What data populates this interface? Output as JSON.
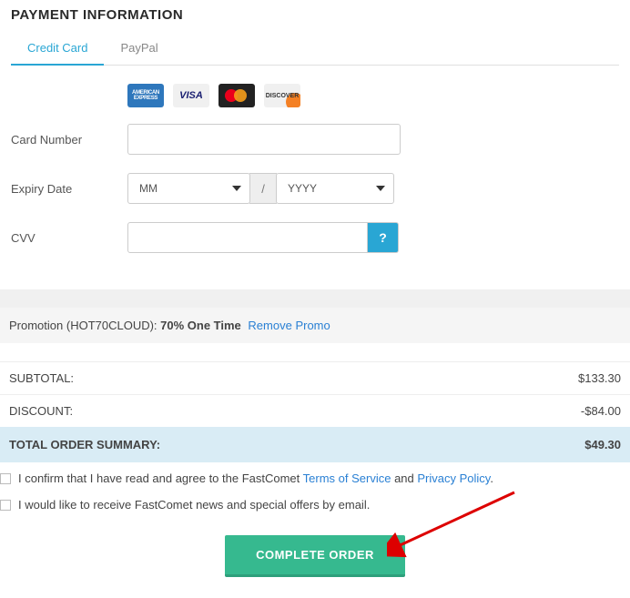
{
  "section_title": "PAYMENT INFORMATION",
  "tabs": {
    "credit_card": "Credit Card",
    "paypal": "PayPal"
  },
  "cards": {
    "amex": "AMERICAN EXPRESS",
    "visa": "VISA",
    "discover": "DISCOVER"
  },
  "labels": {
    "card_number": "Card Number",
    "expiry": "Expiry Date",
    "cvv": "CVV",
    "mm": "MM",
    "yyyy": "YYYY",
    "slash": "/"
  },
  "cvv_help": "?",
  "promo": {
    "prefix": "Promotion (HOT70CLOUD): ",
    "value": "70% One Time",
    "remove": "Remove Promo"
  },
  "summary": {
    "subtotal_label": "SUBTOTAL:",
    "subtotal_value": "$133.30",
    "discount_label": "DISCOUNT:",
    "discount_value": "-$84.00",
    "total_label": "TOTAL ORDER SUMMARY:",
    "total_value": "$49.30"
  },
  "agree": {
    "pre": "I confirm that I have read and agree to the FastComet ",
    "tos": "Terms of Service",
    "and": " and ",
    "privacy": "Privacy Policy",
    "dot": "."
  },
  "newsletter": "I would like to receive FastComet news and special offers by email.",
  "button": "COMPLETE ORDER"
}
